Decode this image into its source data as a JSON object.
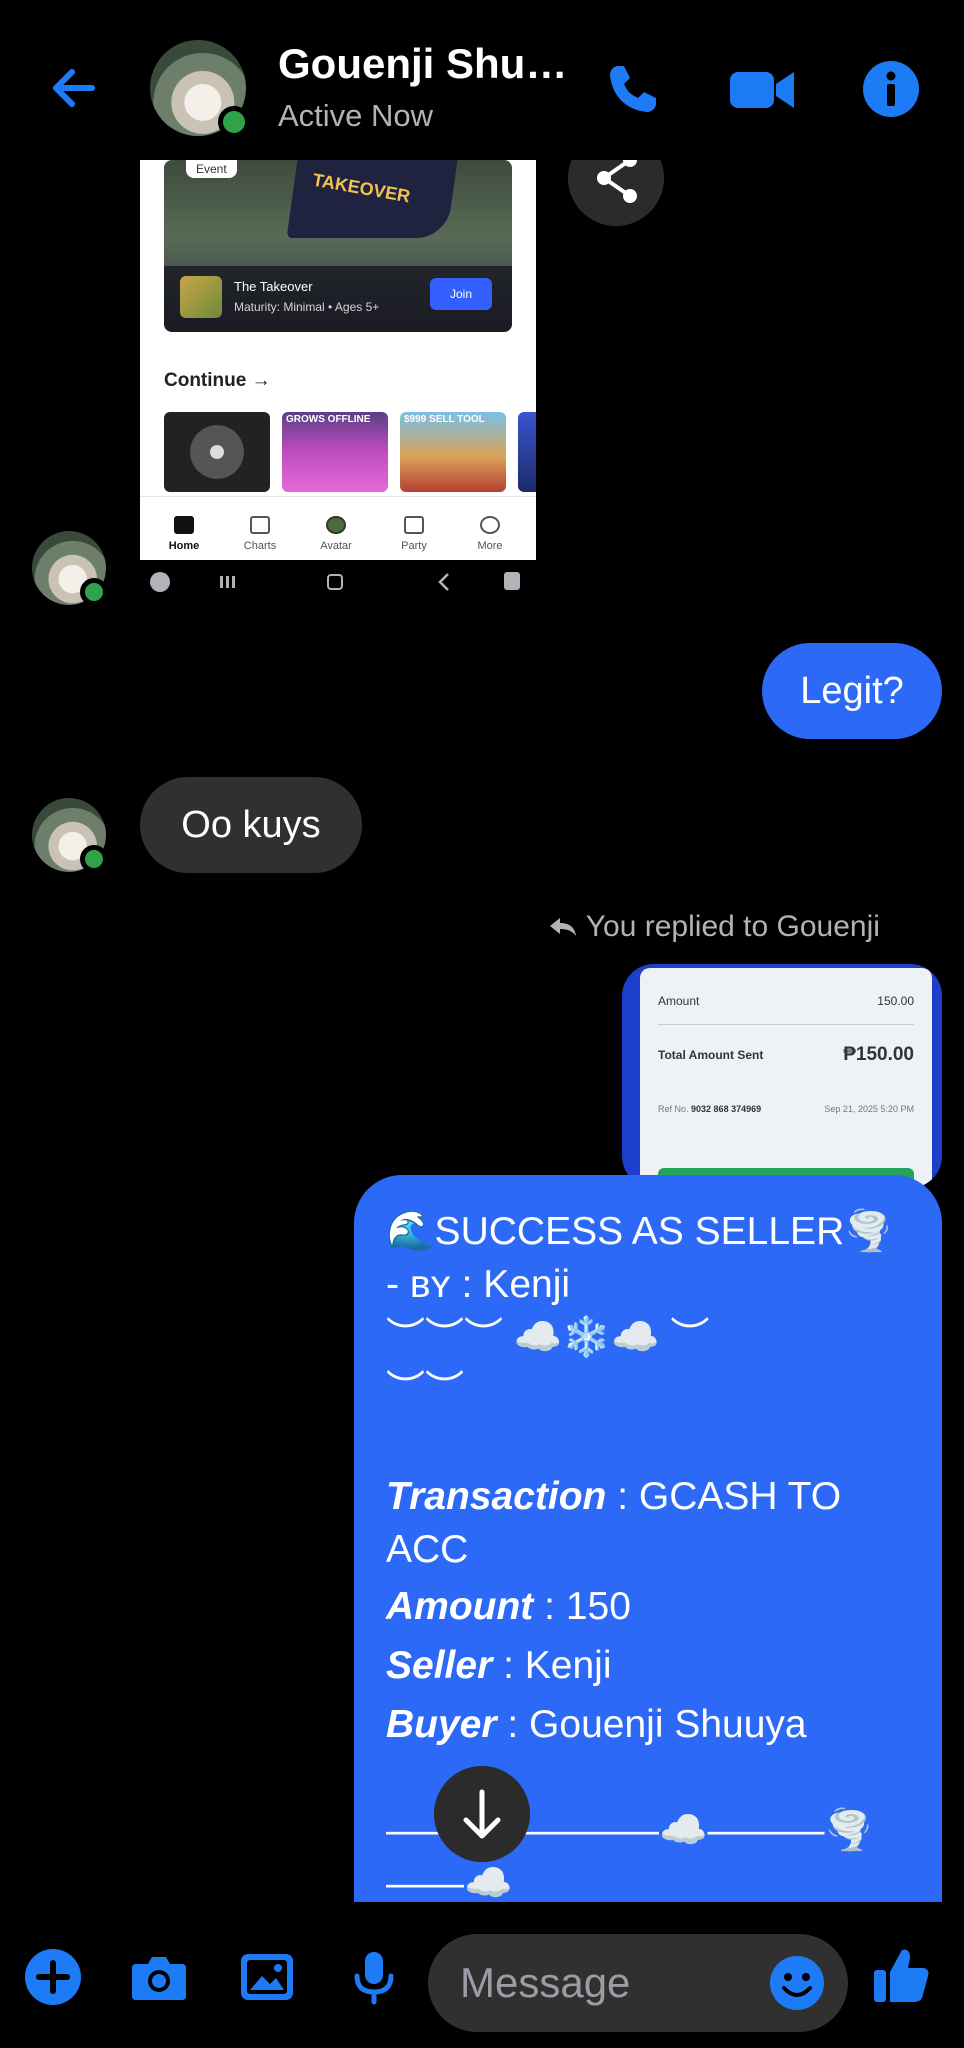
{
  "header": {
    "name": "Gouenji Shu…",
    "status": "Active Now"
  },
  "shared_image": {
    "event_tag": "Event",
    "flag_text": "TAKEOVER",
    "event_title": "The Takeover",
    "event_subtitle": "Maturity: Minimal • Ages 5+",
    "join_label": "Join",
    "continue_label": "Continue →",
    "tiles": [
      "",
      "GROWS OFFLINE",
      "$999 SELL TOOL",
      ""
    ],
    "nav": [
      "Home",
      "Charts",
      "Avatar",
      "Party",
      "More"
    ]
  },
  "messages": {
    "legit": "Legit?",
    "oo_kuys": "Oo kuys",
    "reply_label": "You replied to Gouenji"
  },
  "receipt": {
    "amount_label": "Amount",
    "amount_value": "150.00",
    "total_label": "Total Amount Sent",
    "total_value": "₱150.00",
    "ref_label": "Ref No.",
    "ref_value": "9032 868 374969",
    "ref_date": "Sep 21, 2025 5:20 PM"
  },
  "big_message": {
    "line1": "🌊SUCCESS AS SELLER🌪️",
    "line2": "- ʙʏ : Kenji",
    "line3": "︶︶︶ ☁️❄️☁️ ︶",
    "line4": "︶︶",
    "transaction_label": "Transaction",
    "transaction_value": " : GCASH TO",
    "transaction_value2": "ACC",
    "amount_label": "Amount",
    "amount_value": " : 150",
    "seller_label": "Seller",
    "seller_value": " : Kenji",
    "buyer_label": "Buyer",
    "buyer_value": " : Gouenji Shuuya",
    "divider1": "———————☁️———🌪️",
    "divider2": "——☁️"
  },
  "composer": {
    "placeholder": "Message"
  },
  "colors": {
    "accent": "#2b69f6",
    "icon_blue": "#1e7bf6",
    "bubble_in": "#303030",
    "online": "#31a24c"
  }
}
